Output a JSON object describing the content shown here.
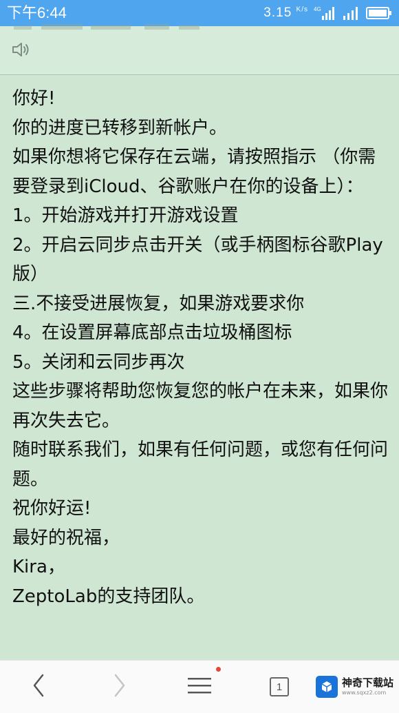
{
  "status_bar": {
    "time": "下午6:44",
    "speed": "3.15",
    "speed_unit": "K/s",
    "network": "4G"
  },
  "message": {
    "lines": [
      "你好!",
      "你的进度已转移到新帐户。",
      "如果你想将它保存在云端，请按照指示 （你需要登录到iCloud、谷歌账户在你的设备上）：",
      "1。开始游戏并打开游戏设置",
      "2。开启云同步点击开关（或手柄图标谷歌Play版）",
      "三.不接受进展恢复，如果游戏要求你",
      "4。在设置屏幕底部点击垃圾桶图标",
      "5。关闭和云同步再次",
      "这些步骤将帮助您恢复您的帐户在未来，如果你再次失去它。",
      "随时联系我们，如果有任何问题，或您有任何问题。",
      "祝你好运!",
      "最好的祝福，",
      "Kira，",
      "ZeptoLab的支持团队。"
    ]
  },
  "bottom_bar": {
    "tab_count": "1"
  },
  "watermark": {
    "title": "神奇下载站",
    "subtitle": "www.sqxz2.com"
  },
  "icons": {
    "speaker": "speaker-icon",
    "back": "back-arrow-icon",
    "forward": "forward-arrow-icon",
    "menu": "menu-icon",
    "tabs": "tabs-icon",
    "signal": "signal-icon",
    "battery": "battery-icon"
  },
  "colors": {
    "status_bar": "#4fa6ef",
    "reading_background": "#cfe6d3",
    "notification_dot": "#e2473c"
  }
}
